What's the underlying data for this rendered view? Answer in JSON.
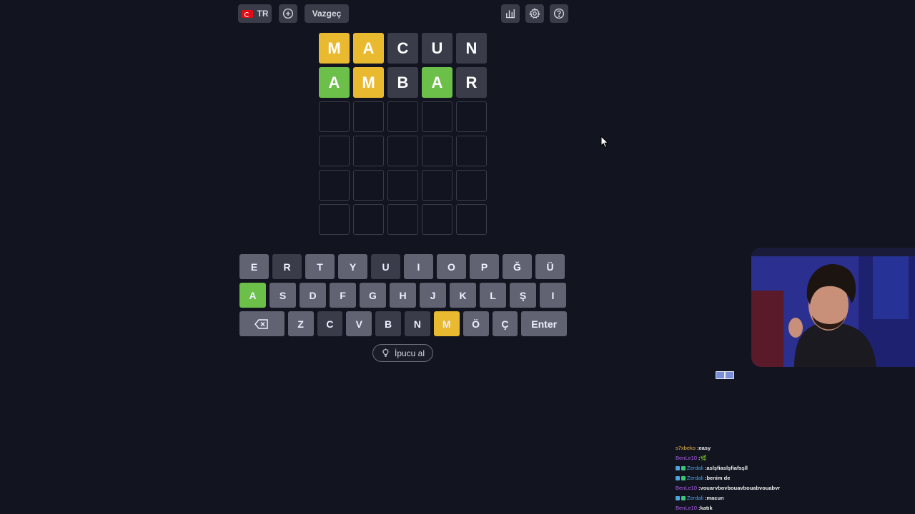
{
  "topbar": {
    "lang_label": "TR",
    "cancel_label": "Vazgeç"
  },
  "board": {
    "rows": [
      [
        {
          "l": "M",
          "s": "yellow"
        },
        {
          "l": "A",
          "s": "yellow"
        },
        {
          "l": "C",
          "s": "gray"
        },
        {
          "l": "U",
          "s": "gray"
        },
        {
          "l": "N",
          "s": "gray"
        }
      ],
      [
        {
          "l": "A",
          "s": "green"
        },
        {
          "l": "M",
          "s": "yellow"
        },
        {
          "l": "B",
          "s": "gray"
        },
        {
          "l": "A",
          "s": "green"
        },
        {
          "l": "R",
          "s": "gray"
        }
      ],
      [
        {
          "l": "",
          "s": "empty"
        },
        {
          "l": "",
          "s": "empty"
        },
        {
          "l": "",
          "s": "empty"
        },
        {
          "l": "",
          "s": "empty"
        },
        {
          "l": "",
          "s": "empty"
        }
      ],
      [
        {
          "l": "",
          "s": "empty"
        },
        {
          "l": "",
          "s": "empty"
        },
        {
          "l": "",
          "s": "empty"
        },
        {
          "l": "",
          "s": "empty"
        },
        {
          "l": "",
          "s": "empty"
        }
      ],
      [
        {
          "l": "",
          "s": "empty"
        },
        {
          "l": "",
          "s": "empty"
        },
        {
          "l": "",
          "s": "empty"
        },
        {
          "l": "",
          "s": "empty"
        },
        {
          "l": "",
          "s": "empty"
        }
      ],
      [
        {
          "l": "",
          "s": "empty"
        },
        {
          "l": "",
          "s": "empty"
        },
        {
          "l": "",
          "s": "empty"
        },
        {
          "l": "",
          "s": "empty"
        },
        {
          "l": "",
          "s": "empty"
        }
      ]
    ]
  },
  "keyboard": {
    "rows": [
      [
        {
          "k": "E",
          "s": "light"
        },
        {
          "k": "R",
          "s": "dark"
        },
        {
          "k": "T",
          "s": "light"
        },
        {
          "k": "Y",
          "s": "light"
        },
        {
          "k": "U",
          "s": "dark"
        },
        {
          "k": "I",
          "s": "light"
        },
        {
          "k": "O",
          "s": "light"
        },
        {
          "k": "P",
          "s": "light"
        },
        {
          "k": "Ğ",
          "s": "light"
        },
        {
          "k": "Ü",
          "s": "light"
        }
      ],
      [
        {
          "k": "A",
          "s": "green"
        },
        {
          "k": "S",
          "s": "light"
        },
        {
          "k": "D",
          "s": "light"
        },
        {
          "k": "F",
          "s": "light"
        },
        {
          "k": "G",
          "s": "light"
        },
        {
          "k": "H",
          "s": "light"
        },
        {
          "k": "J",
          "s": "light"
        },
        {
          "k": "K",
          "s": "light"
        },
        {
          "k": "L",
          "s": "light"
        },
        {
          "k": "Ş",
          "s": "light"
        },
        {
          "k": "I",
          "s": "light"
        }
      ],
      [
        {
          "k": "⌫",
          "s": "light",
          "name": "backspace-key"
        },
        {
          "k": "Z",
          "s": "light"
        },
        {
          "k": "C",
          "s": "dark"
        },
        {
          "k": "V",
          "s": "light"
        },
        {
          "k": "B",
          "s": "dark"
        },
        {
          "k": "N",
          "s": "dark"
        },
        {
          "k": "M",
          "s": "yellow"
        },
        {
          "k": "Ö",
          "s": "light"
        },
        {
          "k": "Ç",
          "s": "light"
        },
        {
          "k": "Enter",
          "s": "light",
          "name": "enter-key"
        }
      ]
    ]
  },
  "hint": {
    "label": "İpucu al"
  },
  "icons": {
    "new_game": "plus-circle-icon",
    "stats": "bar-chart-icon",
    "settings": "gear-icon",
    "help": "question-circle-icon",
    "hint": "lightbulb-icon",
    "cursor": "mouse-pointer-icon"
  },
  "colors": {
    "green": "#6cbf49",
    "yellow": "#e9b930",
    "absent": "#3a3c4a",
    "key": "#616373",
    "background": "#121420"
  },
  "chat": [
    {
      "user": "s7xbeko",
      "color": "#e8b84a",
      "badges": [],
      "msg": "easy"
    },
    {
      "user": "BenLe10",
      "color": "#b15cf0",
      "badges": [],
      "msg": "🌿"
    },
    {
      "user": "Zerdali",
      "color": "#4fa3e0",
      "badges": [
        "#4fa3e0",
        "#3cc47a"
      ],
      "msg": "aslşfiaslşfiafsşll"
    },
    {
      "user": "Zerdali",
      "color": "#4fa3e0",
      "badges": [
        "#4fa3e0",
        "#3cc47a"
      ],
      "msg": "benim de"
    },
    {
      "user": "BenLe10",
      "color": "#b15cf0",
      "badges": [],
      "msg": "vouarvbovbouavbouabvouabvr"
    },
    {
      "user": "Zerdali",
      "color": "#4fa3e0",
      "badges": [
        "#4fa3e0",
        "#3cc47a"
      ],
      "msg": "macun"
    },
    {
      "user": "BenLe10",
      "color": "#b15cf0",
      "badges": [],
      "msg": "katık"
    }
  ]
}
